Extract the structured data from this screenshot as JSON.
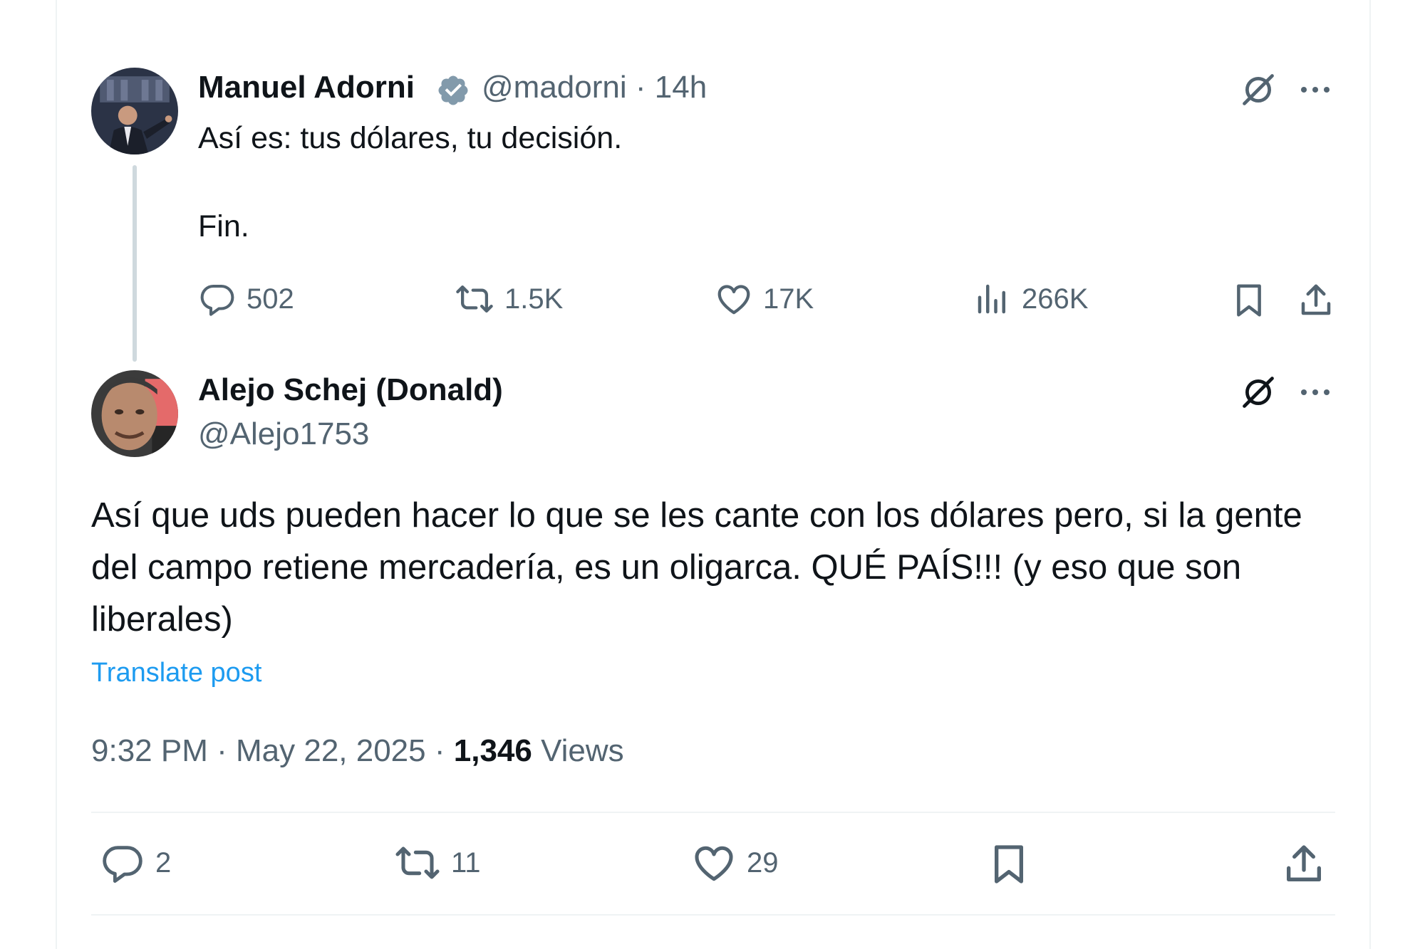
{
  "parent_post": {
    "author_name": "Manuel Adorni",
    "handle": "@madorni",
    "separator": "·",
    "time": "14h",
    "text": "Así es: tus dólares, tu decisión.\n\nFin.",
    "stats": {
      "replies": "502",
      "reposts": "1.5K",
      "likes": "17K",
      "views": "266K"
    }
  },
  "main_post": {
    "author_name": "Alejo Schej (Donald)",
    "handle": "@Alejo1753",
    "text": "Así que uds pueden hacer lo que se les cante con los dólares pero, si la gente del campo retiene mercadería, es un oligarca. QUÉ PAÍS!!! (y eso que son liberales)",
    "translate_label": "Translate post",
    "time": "9:32 PM",
    "date": "May 22, 2025",
    "views_count": "1,346",
    "views_label": "Views",
    "dot": "·",
    "stats": {
      "replies": "2",
      "reposts": "11",
      "likes": "29"
    }
  },
  "colors": {
    "text": "#0f1419",
    "muted": "#536471",
    "link": "#1d9bf0",
    "verified_badge": "#829aab",
    "thread_line": "#cfd9de"
  },
  "icons": [
    "grok-icon",
    "more-icon",
    "reply-icon",
    "repost-icon",
    "like-icon",
    "views-icon",
    "bookmark-icon",
    "share-icon",
    "verified-icon"
  ]
}
